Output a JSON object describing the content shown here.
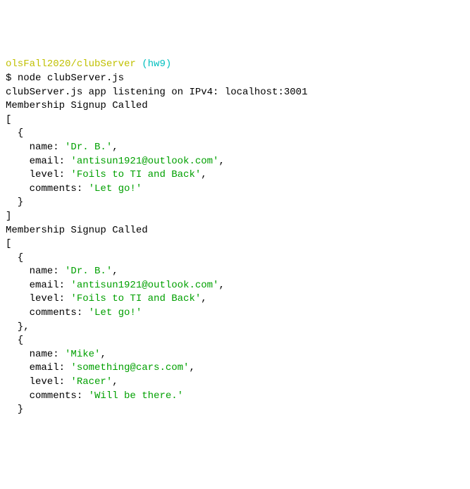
{
  "prompt": {
    "path": "olsFall2020/clubServer",
    "branch": "(hw9)",
    "symbol": "$",
    "command": "node clubServer.js"
  },
  "lines": {
    "listen": "clubServer.js app listening on IPv4: localhost:3001",
    "signup": "Membership Signup Called",
    "openBracket": "[",
    "closeBracket": "]",
    "openBrace": "  {",
    "closeBrace": "  }",
    "closeBraceComma": "  },"
  },
  "labels": {
    "name": "    name: ",
    "email": "    email: ",
    "level": "    level: ",
    "comments": "    comments: "
  },
  "records": [
    {
      "name": "'Dr. B.'",
      "email": "'antisun1921@outlook.com'",
      "level": "'Foils to TI and Back'",
      "comments": "'Let go!'"
    },
    {
      "name": "'Mike'",
      "email": "'something@cars.com'",
      "level": "'Racer'",
      "comments": "'Will be there.'"
    }
  ],
  "comma": ","
}
